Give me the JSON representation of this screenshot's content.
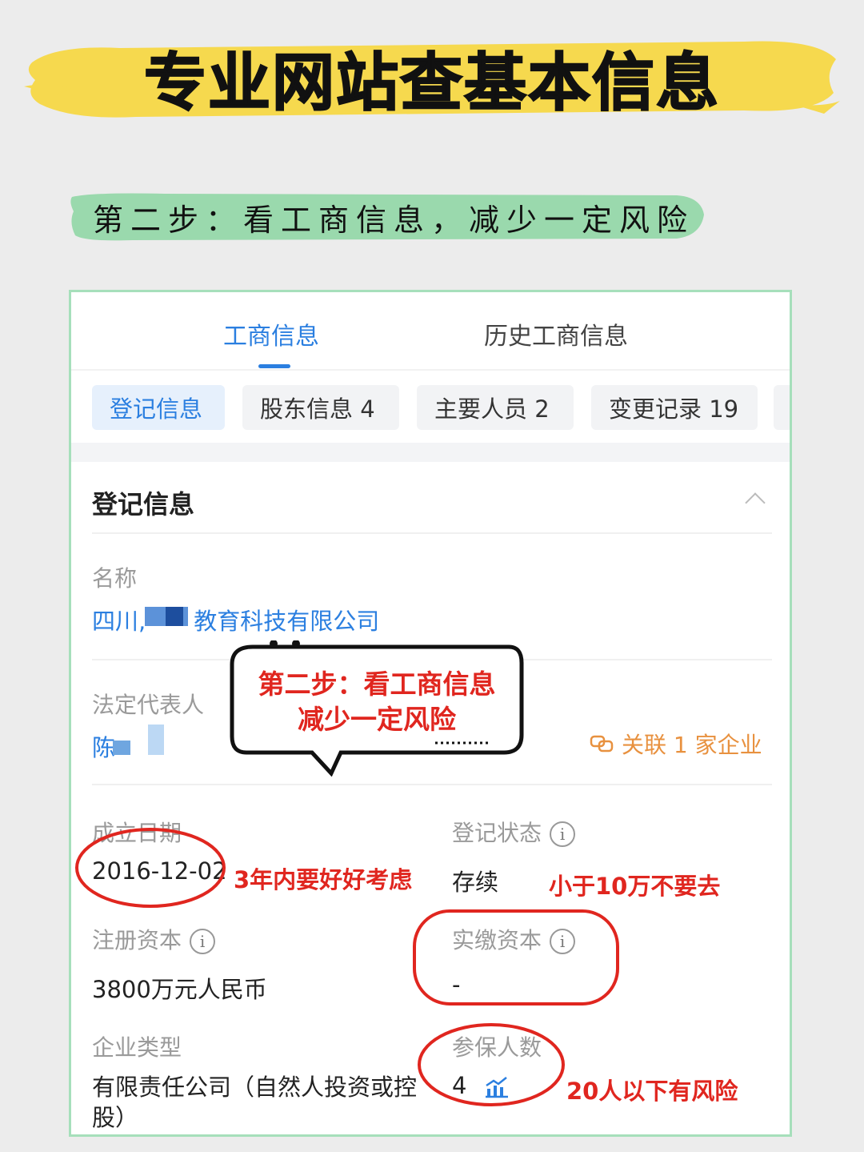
{
  "header": {
    "title": "专业网站查基本信息",
    "step": "第二步：看工商信息，减少一定风险"
  },
  "tabs": [
    {
      "label": "工商信息",
      "active": true
    },
    {
      "label": "历史工商信息",
      "active": false
    }
  ],
  "chips": [
    {
      "label": "登记信息",
      "active": true
    },
    {
      "label": "股东信息 4",
      "active": false
    },
    {
      "label": "主要人员 2",
      "active": false
    },
    {
      "label": "变更记录 19",
      "active": false
    }
  ],
  "section": {
    "title": "登记信息",
    "name_label": "名称",
    "name_value_prefix": "四川,",
    "name_value_suffix": "教育科技有限公司",
    "legal_rep_label": "法定代表人",
    "legal_rep_value": "陈",
    "related": "关联 1 家企业",
    "founded_label": "成立日期",
    "founded_value": "2016-12-02",
    "status_label": "登记状态",
    "status_value": "存续",
    "reg_capital_label": "注册资本",
    "reg_capital_value": "3800万元人民币",
    "paid_capital_label": "实缴资本",
    "paid_capital_value": "-",
    "company_type_label": "企业类型",
    "company_type_value": "有限责任公司（自然人投资或控股）",
    "insured_label": "参保人数",
    "insured_value": "4"
  },
  "annotations": {
    "bubble_line1": "第二步：看工商信息",
    "bubble_line2": "减少一定风险",
    "founded_note": "3年内要好好考虑",
    "paid_note": "小于10万不要去",
    "insured_note": "20人以下有风险"
  },
  "colors": {
    "accent_blue": "#2b7fe0",
    "annotation_red": "#e0261f",
    "related_orange": "#e8913f",
    "banner_yellow": "#f6d94e",
    "banner_green": "#9ad9ad",
    "card_border": "#a6dfbb"
  }
}
